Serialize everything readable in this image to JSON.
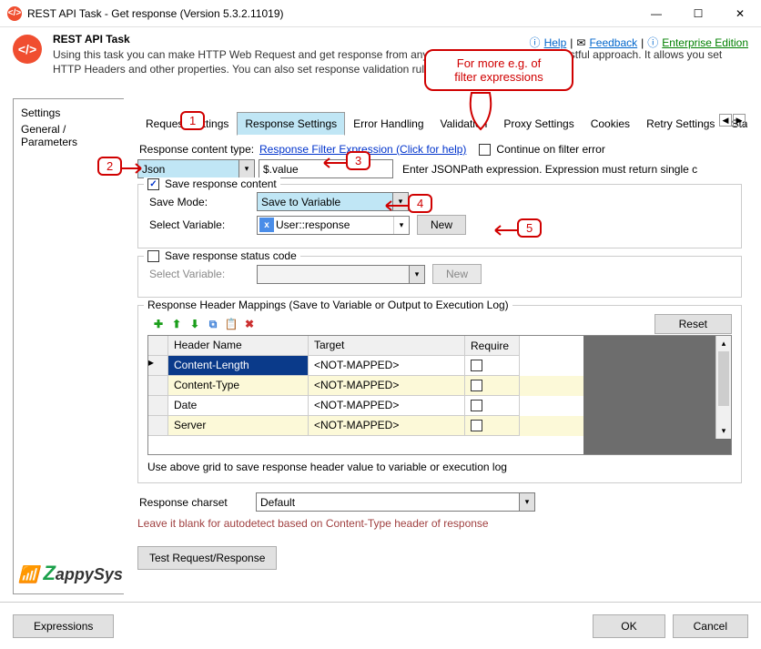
{
  "window": {
    "title": "REST API Task - Get response (Version 5.3.2.11019)"
  },
  "header": {
    "title": "REST API Task",
    "description": "Using this task you can make HTTP Web Request and get response from any HTTP compliat URL using restful approach. It allows you set HTTP Headers and other properties. You can also set response validation rules and filter response.",
    "help": "Help",
    "feedback": "Feedback",
    "enterprise": "Enterprise Edition"
  },
  "sidebar": {
    "items": [
      "Settings",
      "General / Parameters"
    ]
  },
  "tabs": [
    "Request Settings",
    "Response Settings",
    "Error Handling",
    "Validation",
    "Proxy Settings",
    "Cookies",
    "Retry Settings",
    "Status Ch"
  ],
  "content": {
    "content_type_label": "Response content type:",
    "content_type_value": "Json",
    "filter_link": "Response Filter Expression (Click for help)",
    "filter_value": "$.value",
    "continue_on_error": "Continue on filter error",
    "jsonpath_hint": "Enter JSONPath expression. Expression must return single c",
    "save_content": "Save response content",
    "save_mode_label": "Save Mode:",
    "save_mode_value": "Save to Variable",
    "select_var_label": "Select Variable:",
    "select_var_value": "User::response",
    "new_btn": "New",
    "status_code_legend": "Save response status code",
    "status_var_label": "Select Variable:",
    "mappings_legend": "Response Header Mappings (Save to Variable or Output to Execution Log)",
    "reset_btn": "Reset",
    "grid_headers": [
      "Header Name",
      "Target",
      "Require"
    ],
    "grid_rows": [
      {
        "name": "Content-Length",
        "target": "<NOT-MAPPED>"
      },
      {
        "name": "Content-Type",
        "target": "<NOT-MAPPED>"
      },
      {
        "name": "Date",
        "target": "<NOT-MAPPED>"
      },
      {
        "name": "Server",
        "target": "<NOT-MAPPED>"
      }
    ],
    "grid_hint": "Use above grid to save response header value to variable or execution log",
    "charset_label": "Response charset",
    "charset_value": "Default",
    "charset_hint": "Leave it blank for autodetect based on Content-Type header of response",
    "test_btn": "Test Request/Response"
  },
  "footer": {
    "expressions": "Expressions",
    "ok": "OK",
    "cancel": "Cancel"
  },
  "annotations": {
    "callout": "For more e.g. of\nfilter expressions",
    "b1": "1",
    "b2": "2",
    "b3": "3",
    "b4": "4",
    "b5": "5"
  },
  "logo": {
    "pre": "Z",
    "rest": "appySys"
  }
}
